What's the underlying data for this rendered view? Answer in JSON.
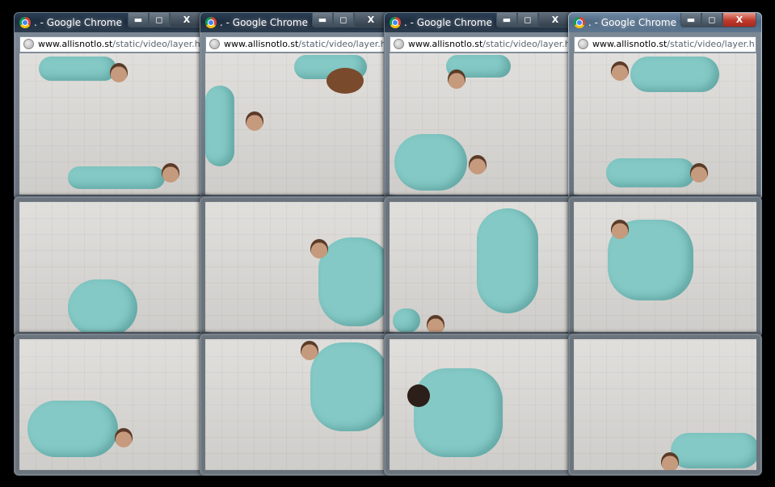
{
  "chrome_window": {
    "title": ". - Google Chrome",
    "url_host": "www.allisnotlo.st",
    "url_path": "/static/video/layer.h",
    "buttons": {
      "minimize": "▬",
      "maximize": "◻",
      "close": "X"
    }
  },
  "accent_colors": {
    "frame": "#7c8894",
    "titlebar": "#1d2d3f",
    "close_active": "#c0392b",
    "suit": "#84c9c5",
    "floor": "#d9d7d4"
  }
}
